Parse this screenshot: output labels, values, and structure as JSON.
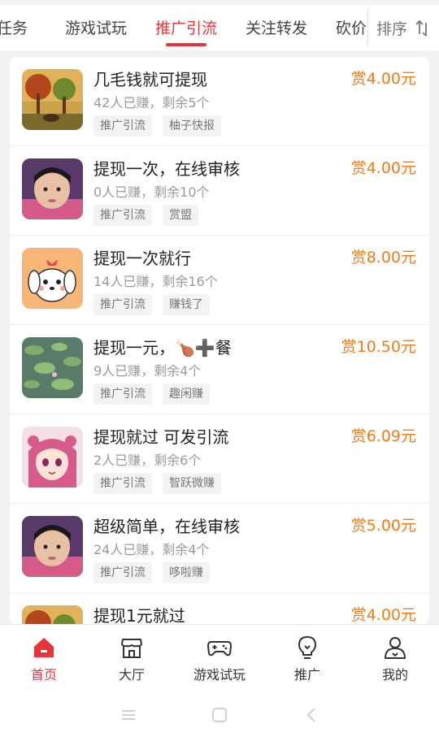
{
  "tabs": {
    "items": [
      "任务",
      "游戏试玩",
      "推广引流",
      "关注转发",
      "砍价"
    ],
    "sort_label": "排序",
    "accent": "#e8333b"
  },
  "tasks": [
    {
      "title": "几毛钱就可提现",
      "stats": "42人已赚，剩余5个",
      "reward": "赏4.00元",
      "tags": [
        "推广引流",
        "柚子快报"
      ],
      "thumb": "forest-painting"
    },
    {
      "title": "提现一次，在线审核",
      "stats": "0人已赚，剩余10个",
      "reward": "赏4.00元",
      "tags": [
        "推广引流",
        "赏盟"
      ],
      "thumb": "child-photo"
    },
    {
      "title": "提现一次就行",
      "stats": "14人已赚，剩余16个",
      "reward": "赏8.00元",
      "tags": [
        "推广引流",
        "赚钱了"
      ],
      "thumb": "cartoon-puppy"
    },
    {
      "title": "提现一元，🍗➕餐",
      "stats": "9人已赚，剩余4个",
      "reward": "赏10.50元",
      "tags": [
        "推广引流",
        "趣闲赚"
      ],
      "thumb": "lily-pads"
    },
    {
      "title": "提现就过 可发引流",
      "stats": "2人已赚，剩余6个",
      "reward": "赏6.09元",
      "tags": [
        "推广引流",
        "智跃微赚"
      ],
      "thumb": "anime-girl"
    },
    {
      "title": "超级简单，在线审核",
      "stats": "24人已赚，剩余4个",
      "reward": "赏5.00元",
      "tags": [
        "推广引流",
        "哆啦赚"
      ],
      "thumb": "child-photo"
    },
    {
      "title": "提现1元就过",
      "stats": "",
      "reward": "赏4.00元",
      "tags": [],
      "thumb": "forest-painting"
    }
  ],
  "bottom_nav": [
    {
      "label": "首页",
      "icon": "home-icon",
      "active": true
    },
    {
      "label": "大厅",
      "icon": "store-icon",
      "active": false
    },
    {
      "label": "游戏试玩",
      "icon": "gamepad-icon",
      "active": false
    },
    {
      "label": "推广",
      "icon": "lightbulb-icon",
      "active": false
    },
    {
      "label": "我的",
      "icon": "user-icon",
      "active": false
    }
  ],
  "colors": {
    "reward": "#ef7b1a",
    "tag_bg": "#f3f3f3",
    "muted": "#9a9a9a"
  }
}
